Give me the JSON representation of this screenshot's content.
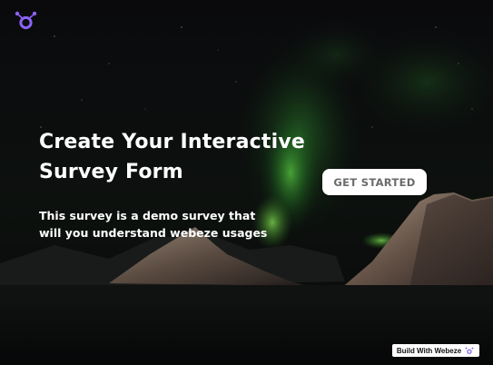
{
  "brand": {
    "logo_icon": "webeze-logo-icon",
    "accent": "#7b57f0"
  },
  "hero": {
    "title": "Create Your Interactive Survey Form",
    "subtitle": "This survey is a demo survey that will you understand webeze usages"
  },
  "cta": {
    "label": "GET STARTED"
  },
  "badge": {
    "label": "Build With Webeze"
  },
  "background": {
    "description_icon": "aurora-mountains-image"
  }
}
